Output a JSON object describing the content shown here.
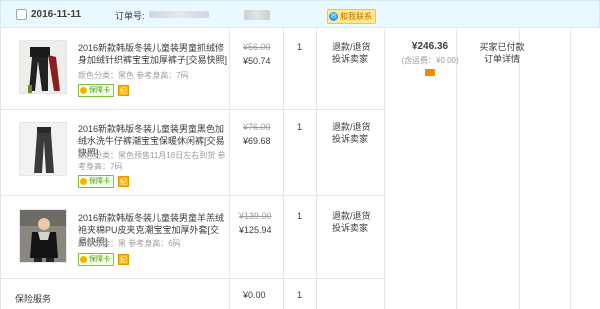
{
  "order": {
    "date": "2016-11-11",
    "order_no_label": "订单号:",
    "contact_label": "和我联系"
  },
  "items": [
    {
      "title": "2016新款韩版冬装儿童装男童抓绒修身加绒针织裤宝宝加厚裤子",
      "snapshot": "[交易快照]",
      "attrs": "颜色分类：黑色  参考身高：7码",
      "badge": "保障卡",
      "badge2": "纪",
      "original_price": "¥56.00",
      "price": "¥50.74",
      "qty": "1",
      "action1": "退款/退货",
      "action2": "投诉卖家"
    },
    {
      "title": "2016新款韩版冬装儿童装男童黑色加绒水洗牛仔裤潮宝宝保暖休闲裤",
      "snapshot": "[交易快照]",
      "attrs": "颜色分类：黑色预售11月18日左右到货  参考身高：7码",
      "badge": "保障卡",
      "badge2": "纪",
      "original_price": "¥76.00",
      "price": "¥69.68",
      "qty": "1",
      "action1": "退款/退货",
      "action2": "投诉卖家"
    },
    {
      "title": "2016新款韩版冬装儿童装男童羊羔绒袍夹棉PU皮夹克潮宝宝加厚外套",
      "snapshot": "[交易快照]",
      "attrs": "颜色分类：黑  参考身高：6码",
      "badge": "保障卡",
      "badge2": "纪",
      "original_price": "¥139.00",
      "price": "¥125.94",
      "qty": "1",
      "action1": "退款/退货",
      "action2": "投诉卖家"
    }
  ],
  "insurance": {
    "label": "保险服务",
    "price": "¥0.00",
    "qty": "1"
  },
  "total": {
    "amount": "¥246.36",
    "shipping": "(含运费：¥0.00)"
  },
  "status": {
    "line1": "买家已付款",
    "line2": "订单详情"
  },
  "colors": {
    "header_bg": "#eaf8ff",
    "contact_bg": "#ffe98a",
    "bao_green": "#4a9d1a",
    "card_orange": "#f08a00"
  }
}
